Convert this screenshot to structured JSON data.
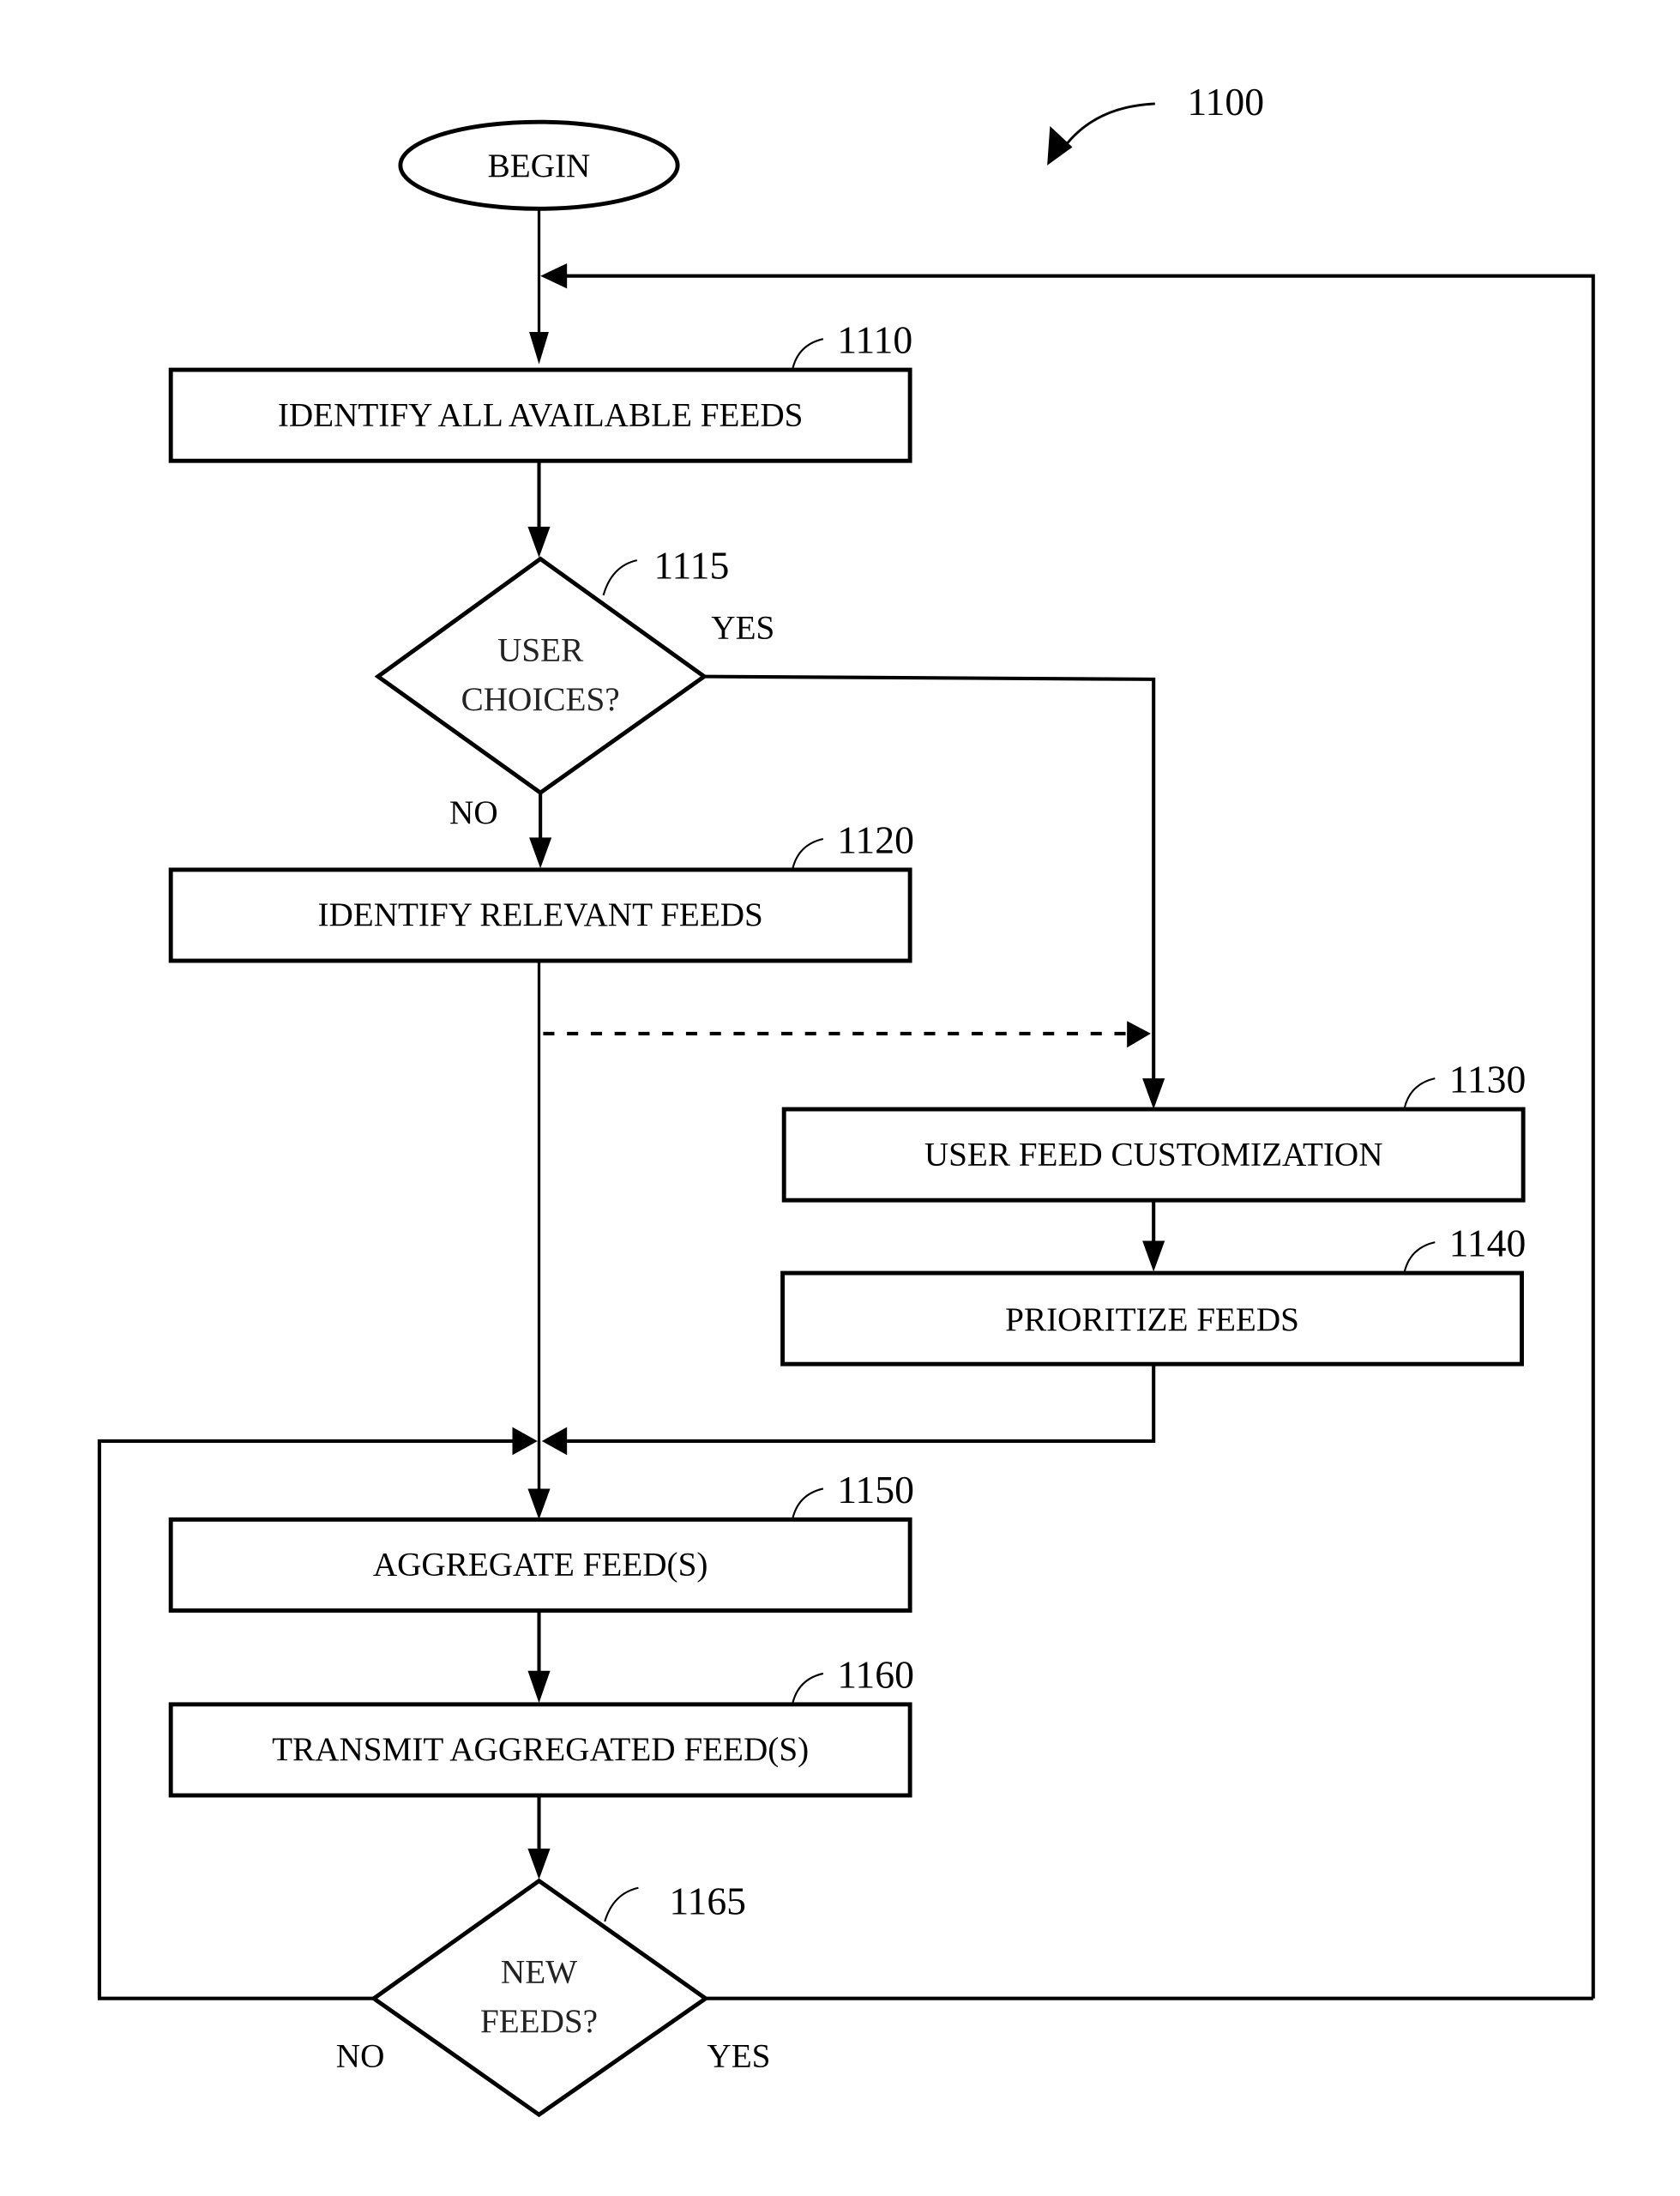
{
  "figure": {
    "ref": "1100",
    "begin_label": "BEGIN"
  },
  "steps": [
    {
      "id": "1110",
      "label": "IDENTIFY ALL AVAILABLE FEEDS",
      "type": "process"
    },
    {
      "id": "1115",
      "label_lines": [
        "USER",
        "CHOICES?"
      ],
      "type": "decision",
      "yes": "YES",
      "no": "NO"
    },
    {
      "id": "1120",
      "label": "IDENTIFY RELEVANT FEEDS",
      "type": "process"
    },
    {
      "id": "1130",
      "label": "USER FEED CUSTOMIZATION",
      "type": "process"
    },
    {
      "id": "1140",
      "label": "PRIORITIZE FEEDS",
      "type": "process"
    },
    {
      "id": "1150",
      "label": "AGGREGATE FEED(S)",
      "type": "process"
    },
    {
      "id": "1160",
      "label": "TRANSMIT AGGREGATED FEED(S)",
      "type": "process"
    },
    {
      "id": "1165",
      "label_lines": [
        "NEW",
        "FEEDS?"
      ],
      "type": "decision",
      "yes": "YES",
      "no": "NO"
    }
  ]
}
